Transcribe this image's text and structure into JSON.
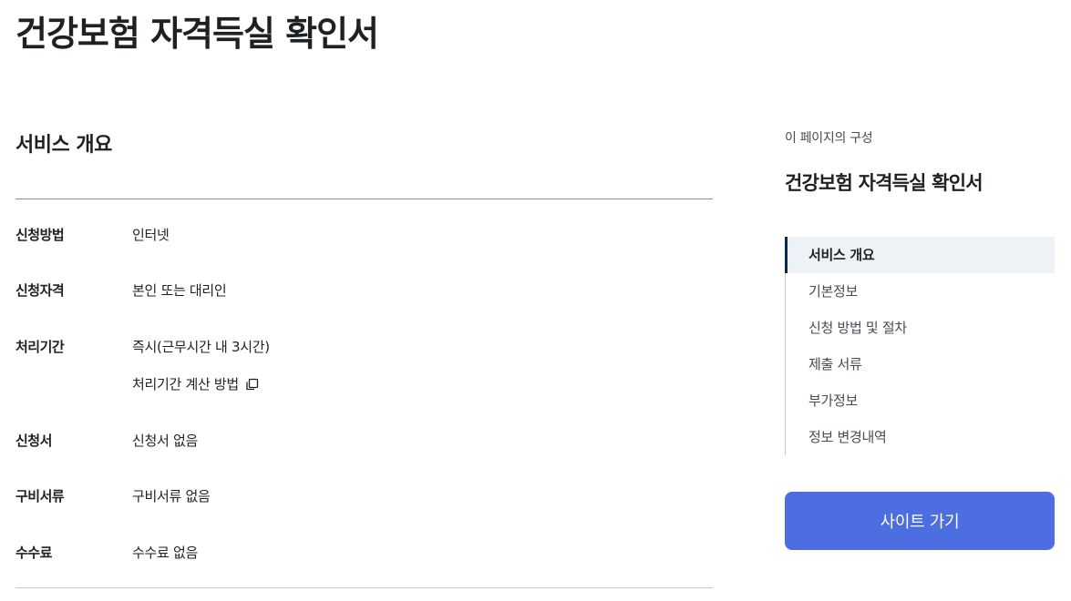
{
  "page": {
    "title": "건강보험 자격득실 확인서"
  },
  "overview": {
    "section_title": "서비스 개요",
    "rows": {
      "method": {
        "label": "신청방법",
        "value": "인터넷"
      },
      "eligibility": {
        "label": "신청자격",
        "value": "본인 또는 대리인"
      },
      "period": {
        "label": "처리기간",
        "value": "즉시(근무시간 내 3시간)",
        "link": "처리기간 계산 방법"
      },
      "form": {
        "label": "신청서",
        "value": "신청서 없음"
      },
      "documents": {
        "label": "구비서류",
        "value": "구비서류 없음"
      },
      "fee": {
        "label": "수수료",
        "value": "수수료 없음"
      }
    }
  },
  "toc": {
    "caption": "이 페이지의 구성",
    "title": "건강보험 자격득실 확인서",
    "items": [
      {
        "label": "서비스 개요",
        "active": true
      },
      {
        "label": "기본정보",
        "active": false
      },
      {
        "label": "신청 방법 및 절차",
        "active": false
      },
      {
        "label": "제출 서류",
        "active": false
      },
      {
        "label": "부가정보",
        "active": false
      },
      {
        "label": "정보 변경내역",
        "active": false
      }
    ]
  },
  "actions": {
    "site_button": "사이트 가기"
  },
  "icons": {
    "copy": "copy-icon"
  },
  "colors": {
    "primary_button": "#4c6ee0",
    "toc_active_bg": "#eef2f7",
    "toc_active_bar": "#052b57",
    "text": "#1e2124"
  }
}
